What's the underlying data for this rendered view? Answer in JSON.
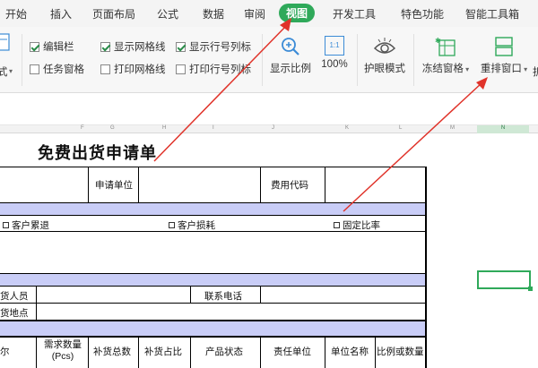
{
  "menu": {
    "items": [
      "开始",
      "插入",
      "页面布局",
      "公式",
      "数据",
      "审阅",
      "视图",
      "开发工具",
      "特色功能",
      "智能工具箱"
    ],
    "active": "视图"
  },
  "ribbon": {
    "left_fragment": "式",
    "checkboxes": [
      {
        "label": "编辑栏",
        "checked": true
      },
      {
        "label": "任务窗格",
        "checked": false
      },
      {
        "label": "显示网格线",
        "checked": true
      },
      {
        "label": "打印网格线",
        "checked": false
      },
      {
        "label": "显示行号列标",
        "checked": true
      },
      {
        "label": "打印行号列标",
        "checked": false
      }
    ],
    "zoom_label": "显示比例",
    "zoom100_label": "100%",
    "zoom100_icon_text": "1:1",
    "eye_label": "护眼模式",
    "freeze_label": "冻结窗格",
    "arrange_label": "重排窗口",
    "more_fragment": "拆"
  },
  "columns": [
    "F",
    "G",
    "H",
    "I",
    "J",
    "K",
    "L",
    "M",
    "N"
  ],
  "sheet": {
    "title": "免费出货申请单",
    "apply_unit": "申请单位",
    "cost_code": "费用代码",
    "opt1": "客户累退",
    "opt2": "客户损耗",
    "opt3": "固定比率",
    "person": "货人员",
    "phone": "联系电话",
    "place": "货地点",
    "col_frag": "尔",
    "headers": [
      "需求数量\n(Pcs)",
      "补货总数",
      "补货占比",
      "产品状态",
      "责任单位",
      "单位名称",
      "比例或数量"
    ]
  },
  "colors": {
    "accent": "#2fa95a",
    "band": "#c9cdf7",
    "arrow": "#e0332a"
  }
}
